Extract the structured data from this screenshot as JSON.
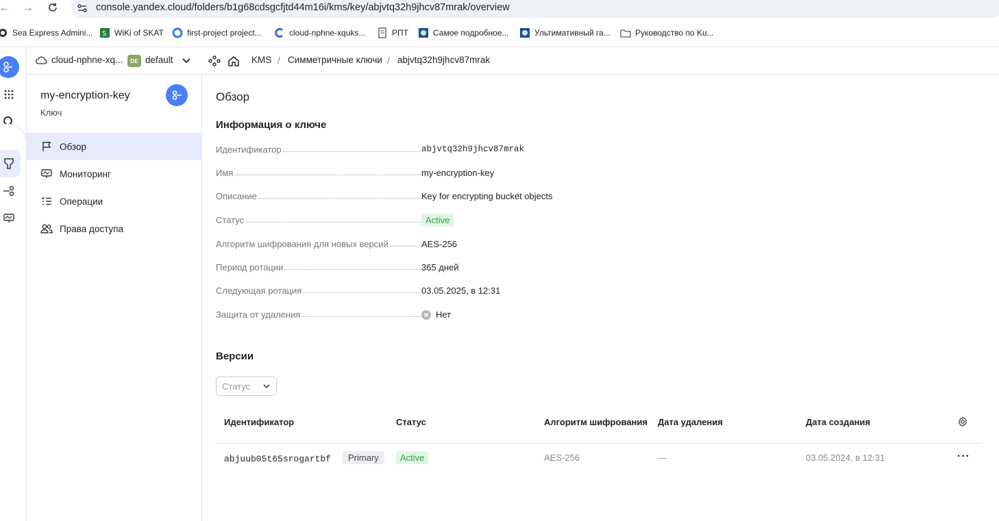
{
  "browser": {
    "url": "console.yandex.cloud/folders/b1g68cdsgcfjtd44m16i/kms/key/abjvtq32h9jhcv87mrak/overview",
    "bookmarks": [
      "Sea Express Admini...",
      "WiKi of SKAT",
      "first-project project...",
      "cloud-nphne-xquks...",
      "РПТ",
      "Самое подробное...",
      "Ультимативный га...",
      "Руководство по Ku..."
    ]
  },
  "topbar": {
    "cloud": "cloud-nphne-xq...",
    "folder_badge": "DE",
    "folder": "default",
    "breadcrumb": [
      "KMS",
      "Симметричные ключи",
      "abjvtq32h9jhcv87mrak"
    ],
    "sep": "/"
  },
  "resource": {
    "name": "my-encryption-key",
    "type": "Ключ"
  },
  "sidenav": [
    {
      "label": "Обзор",
      "icon": "flag-icon"
    },
    {
      "label": "Мониторинг",
      "icon": "monitor-icon"
    },
    {
      "label": "Операции",
      "icon": "list-icon"
    },
    {
      "label": "Права доступа",
      "icon": "people-icon"
    }
  ],
  "main": {
    "title": "Обзор",
    "info_title": "Информация о ключе",
    "info": [
      {
        "label": "Идентификатор",
        "value": "abjvtq32h9jhcv87mrak"
      },
      {
        "label": "Имя",
        "value": "my-encryption-key"
      },
      {
        "label": "Описание",
        "value": "Key for encrypting bucket objects"
      },
      {
        "label": "Статус",
        "value": "Active"
      },
      {
        "label": "Алгоритм шифрования для новых версий",
        "value": "AES-256"
      },
      {
        "label": "Период ротации",
        "value": "365 дней"
      },
      {
        "label": "Следующая ротация",
        "value": "03.05.2025, в 12:31"
      },
      {
        "label": "Защита от удаления",
        "value": "Нет"
      }
    ],
    "versions_title": "Версии",
    "status_filter_placeholder": "Статус",
    "table": {
      "headers": [
        "Идентификатор",
        "Статус",
        "Алгоритм шифрования",
        "Дата удаления",
        "Дата создания"
      ],
      "rows": [
        {
          "id": "abjuub05t65srogartbf",
          "tag": "Primary",
          "status": "Active",
          "algorithm": "AES-256",
          "deleted": "—",
          "created": "03.05.2024, в 12:31"
        }
      ]
    }
  },
  "colors": {
    "accent": "#4a7ef5",
    "active_bg": "#e2f5e4",
    "active_text": "#2e9e45",
    "nav_active": "#e6ebfc"
  }
}
